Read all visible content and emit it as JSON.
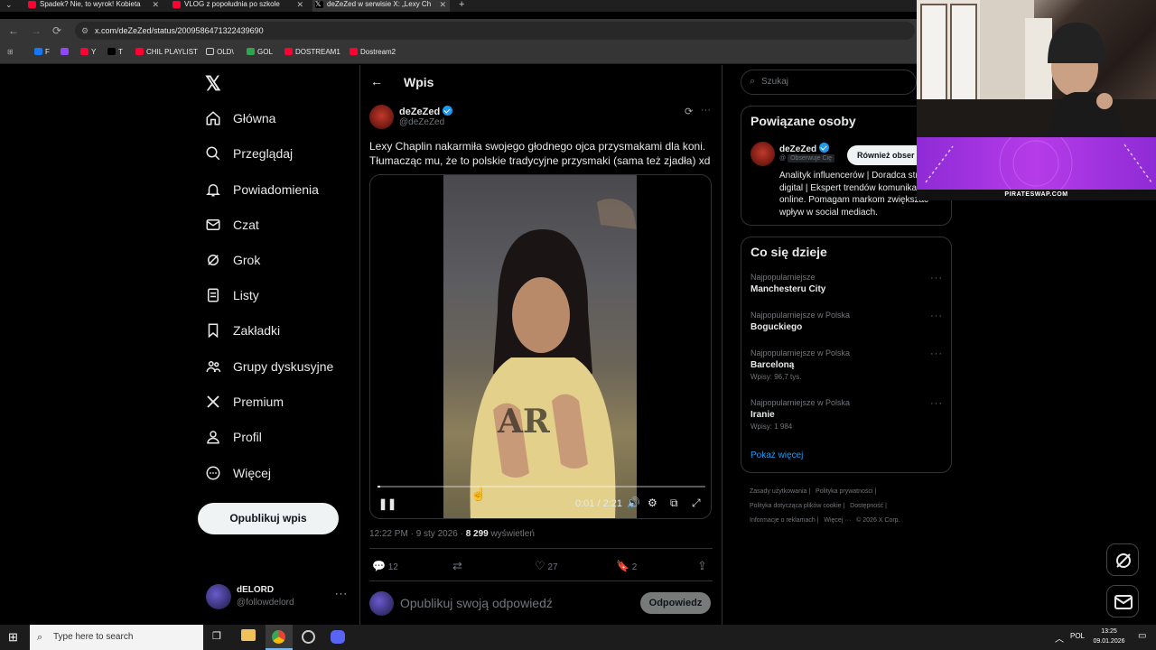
{
  "browser": {
    "tabs": [
      {
        "title": "Spadek? Nie, to wyrok! Kobieta"
      },
      {
        "title": "VLOG z popołudnia po szkole"
      },
      {
        "title": "deZeZed w serwisie X: „Lexy Ch"
      }
    ],
    "url": "x.com/deZeZed/status/2009586471322439690",
    "bookmarks": [
      "F",
      "Y",
      "T",
      "CHIL PLAYLIST",
      "OLD\\",
      "GOL",
      "DOSTREAM1",
      "Dostream2"
    ]
  },
  "nav": {
    "items": [
      "Główna",
      "Przeglądaj",
      "Powiadomienia",
      "Czat",
      "Grok",
      "Listy",
      "Zakładki",
      "Grupy dyskusyjne",
      "Premium",
      "Profil",
      "Więcej"
    ],
    "post_button": "Opublikuj wpis",
    "account_name": "dELORD",
    "account_handle": "@followdelord"
  },
  "post": {
    "header_title": "Wpis",
    "author_name": "deZeZed",
    "author_handle": "@deZeZed",
    "text_line1": "Lexy Chaplin nakarmiła swojego głodnego ojca przysmakami dla koni.",
    "text_line2": "Tłumacząc mu, że to polskie tradycyjne przysmaki (sama też zjadła) xd",
    "video_time": "0:01 / 2:21",
    "video_progress": 0.007,
    "timestamp": "12:22 PM · 9 sty 2026 · ",
    "views_count": "8 299",
    "views_label": "wyświetleń",
    "replies": "12",
    "likes": "27",
    "bookmarks": "2",
    "reply_placeholder": "Opublikuj swoją odpowiedź",
    "reply_button": "Odpowiedz"
  },
  "sidebar": {
    "search_placeholder": "Szukaj",
    "related_title": "Powiązane osoby",
    "related_name": "deZeZed",
    "related_follows_you": "Obserwuje Cię",
    "related_follow_btn": "Również obser",
    "related_bio": "Analityk influencerów | Doradca strategii digital | Ekspert trendów komunikacji online. Pomagam markom zwiększać wpływ w social mediach.",
    "trends_title": "Co się dzieje",
    "trends": [
      {
        "category": "Najpopularniejsze",
        "name": "Manchesteru City",
        "count": ""
      },
      {
        "category": "Najpopularniejsze w Polska",
        "name": "Boguckiego",
        "count": ""
      },
      {
        "category": "Najpopularniejsze w Polska",
        "name": "Barceloną",
        "count": "Wpisy: 96,7 tys."
      },
      {
        "category": "Najpopularniejsze w Polska",
        "name": "Iranie",
        "count": "Wpisy: 1 984"
      }
    ],
    "show_more": "Pokaż więcej",
    "footer_links": [
      "Zasady użytkowania",
      "Polityka prywatności",
      "Polityka dotycząca plików cookie",
      "Dostępność",
      "Informacje o reklamach",
      "Więcej ···",
      "© 2026 X Corp."
    ]
  },
  "overlay": {
    "banner_text": "PIRATESWAP.COM"
  },
  "taskbar": {
    "search_placeholder": "Type here to search",
    "language": "POL",
    "time": "13:25",
    "date": "09.01.2026"
  },
  "colors": {
    "accent": "#1d9bf0",
    "background": "#000000",
    "border": "#2f3336",
    "muted": "#71767b"
  }
}
